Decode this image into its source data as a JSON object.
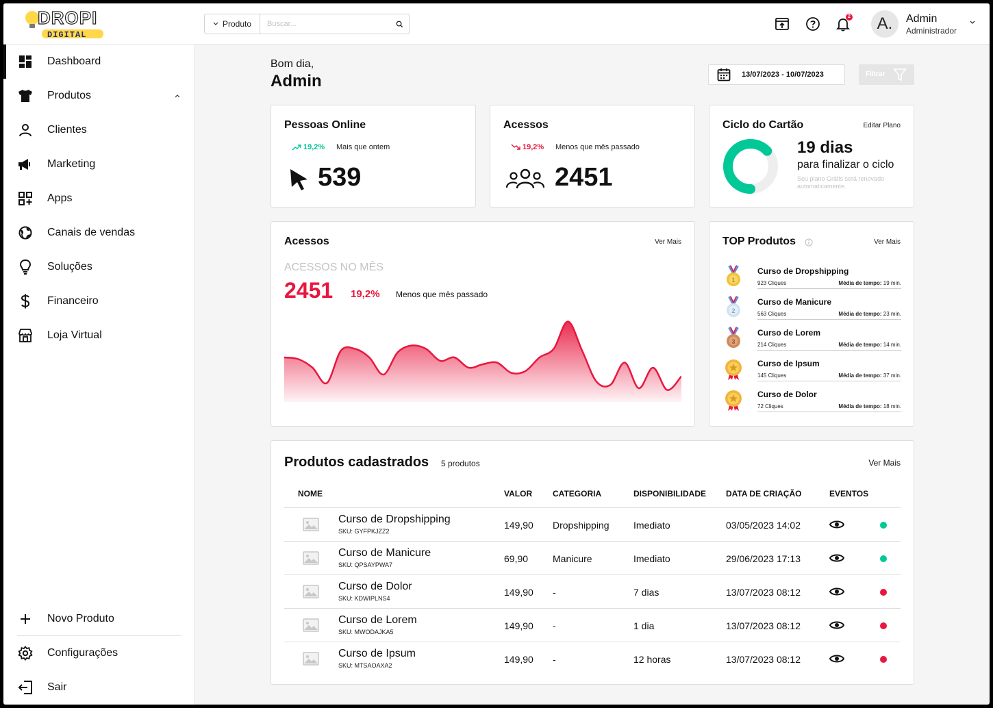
{
  "brand": {
    "logo_top": "DROPI",
    "logo_bottom": "DIGITAL"
  },
  "search": {
    "category": "Produto",
    "placeholder": "Buscar..."
  },
  "header": {
    "notification_count": "2",
    "avatar_initial": "A.",
    "user_name": "Admin",
    "user_role": "Administrador"
  },
  "sidebar": {
    "items": [
      {
        "label": "Dashboard",
        "icon": "dashboard-icon"
      },
      {
        "label": "Produtos",
        "icon": "shirt-icon"
      },
      {
        "label": "Clientes",
        "icon": "user-icon"
      },
      {
        "label": "Marketing",
        "icon": "megaphone-icon"
      },
      {
        "label": "Apps",
        "icon": "apps-icon"
      },
      {
        "label": "Canais de vendas",
        "icon": "globe-icon"
      },
      {
        "label": "Soluções",
        "icon": "lightbulb-icon"
      },
      {
        "label": "Financeiro",
        "icon": "dollar-icon"
      },
      {
        "label": "Loja Virtual",
        "icon": "store-icon"
      }
    ],
    "bottom": [
      {
        "label": "Novo Produto",
        "icon": "plus-icon"
      },
      {
        "label": "Configurações",
        "icon": "gear-icon"
      },
      {
        "label": "Sair",
        "icon": "logout-icon"
      }
    ]
  },
  "greeting": {
    "line1": "Bom dia,",
    "line2": "Admin"
  },
  "date_range": "13/07/2023 - 10/07/2023",
  "filter_label": "Filtrar",
  "kpis": {
    "online": {
      "title": "Pessoas Online",
      "trend": "19,2%",
      "note": "Mais que ontem",
      "value": "539"
    },
    "access": {
      "title": "Acessos",
      "trend": "19,2%",
      "note": "Menos que mês passado",
      "value": "2451"
    }
  },
  "cycle": {
    "title": "Ciclo do Cartão",
    "link": "Editar Plano",
    "days": "19 dias",
    "subtitle": "para finalizar o ciclo",
    "note_line1": "Seu plano Grátis será renovado",
    "note_line2": "automaticamente.",
    "progress": 0.63
  },
  "access_chart": {
    "title": "Acessos",
    "link": "Ver Mais",
    "caption": "ACESSOS NO MÊS",
    "total": "2451",
    "delta": "19,2%",
    "note": "Menos que mês passado",
    "color": "#e8173e",
    "values": [
      52,
      50,
      40,
      22,
      60,
      62,
      52,
      32,
      58,
      66,
      62,
      48,
      52,
      40,
      44,
      46,
      34,
      36,
      52,
      62,
      94,
      60,
      24,
      20,
      46,
      16,
      40,
      14,
      30
    ]
  },
  "top_products": {
    "title": "TOP Produtos",
    "link": "Ver Mais",
    "time_label": "Média de tempo:",
    "items": [
      {
        "name": "Curso de Dropshipping",
        "clicks": "923 Cliques",
        "time": "19 min.",
        "medal": "gold-medal-icon"
      },
      {
        "name": "Curso de Manicure",
        "clicks": "563 Cliques",
        "time": "23 min.",
        "medal": "silver-medal-icon"
      },
      {
        "name": "Curso de Lorem",
        "clicks": "214 Cliques",
        "time": "14 min.",
        "medal": "bronze-medal-icon"
      },
      {
        "name": "Curso de Ipsum",
        "clicks": "145 Cliques",
        "time": "37 min.",
        "medal": "star-badge-icon"
      },
      {
        "name": "Curso de Dolor",
        "clicks": "72 Cliques",
        "time": "18 min.",
        "medal": "star-badge-icon"
      }
    ]
  },
  "products": {
    "title": "Produtos cadastrados",
    "count": "5 produtos",
    "link": "Ver Mais",
    "columns": [
      "NOME",
      "VALOR",
      "CATEGORIA",
      "DISPONIBILIDADE",
      "DATA DE CRIAÇÃO",
      "EVENTOS"
    ],
    "rows": [
      {
        "name": "Curso de Dropshipping",
        "sku": "SKU: GYFPKJZZ2",
        "price": "149,90",
        "category": "Dropshipping",
        "availability": "Imediato",
        "created": "03/05/2023 14:02",
        "status": "#00c896"
      },
      {
        "name": "Curso de Manicure",
        "sku": "SKU: QPSAYPWA7",
        "price": "69,90",
        "category": "Manicure",
        "availability": "Imediato",
        "created": "29/06/2023 17:13",
        "status": "#00c896"
      },
      {
        "name": "Curso de Dolor",
        "sku": "SKU: KDWIPLNS4",
        "price": "149,90",
        "category": "-",
        "availability": "7 dias",
        "created": "13/07/2023 08:12",
        "status": "#e8173e"
      },
      {
        "name": "Curso de Lorem",
        "sku": "SKU: MWODAJKA5",
        "price": "149,90",
        "category": "-",
        "availability": "1 dia",
        "created": "13/07/2023 08:12",
        "status": "#e8173e"
      },
      {
        "name": "Curso de Ipsum",
        "sku": "SKU: MTSAOAXA2",
        "price": "149,90",
        "category": "-",
        "availability": "12 horas",
        "created": "13/07/2023 08:12",
        "status": "#e8173e"
      }
    ]
  },
  "colors": {
    "up": "#00c896",
    "down": "#e8173e"
  }
}
